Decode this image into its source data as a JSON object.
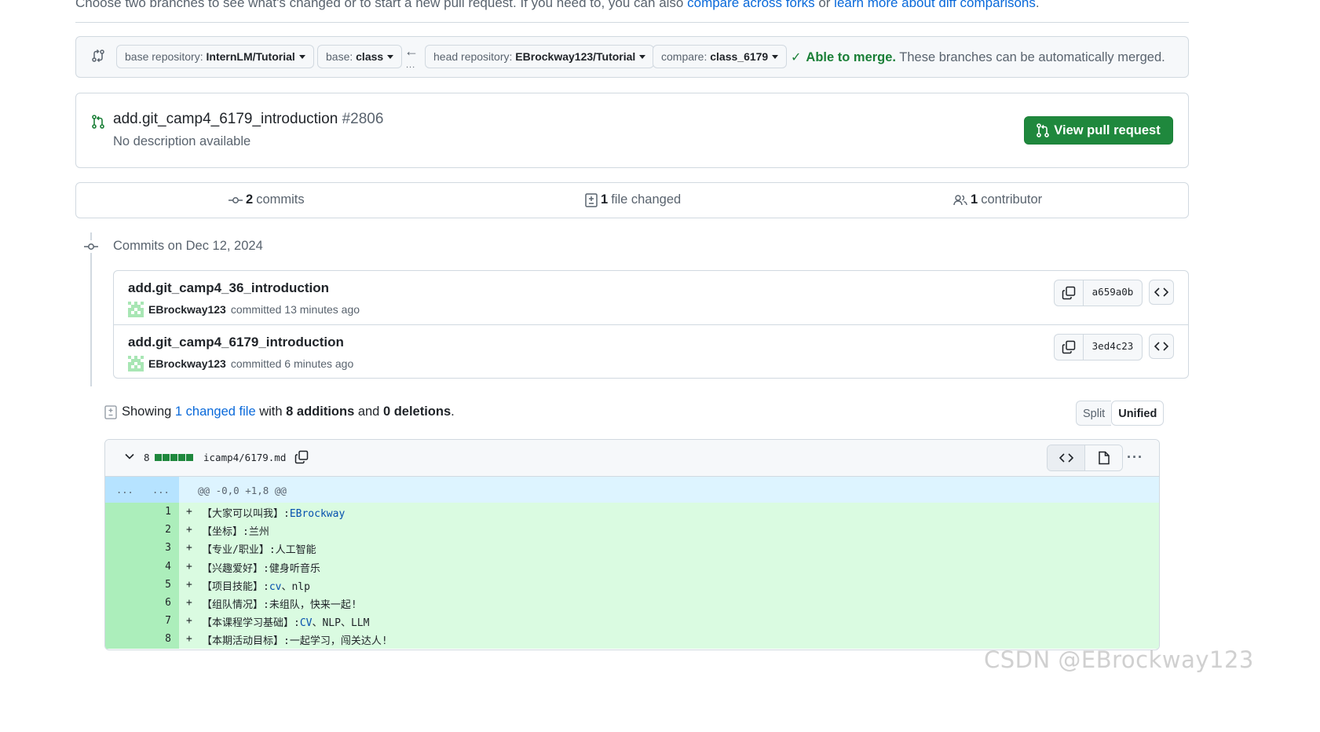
{
  "intro": {
    "text": "Choose two branches to see what's changed or to start a new pull request. If you need to, you can also ",
    "link1": "compare across forks",
    "or": " or ",
    "link2": "learn more about diff comparisons",
    "end": "."
  },
  "range": {
    "base_repo_label": "base repository: ",
    "base_repo_value": "InternLM/Tutorial",
    "base_label": "base: ",
    "base_value": "class",
    "head_repo_label": "head repository: ",
    "head_repo_value": "EBrockway123/Tutorial",
    "compare_label": "compare: ",
    "compare_value": "class_6179",
    "merge_ok": "Able to merge.",
    "merge_text": " These branches can be automatically merged."
  },
  "pr": {
    "title": "add.git_camp4_6179_introduction",
    "number": "#2806",
    "description": "No description available",
    "button": "View pull request"
  },
  "summary": {
    "commits_count": "2",
    "commits_label": " commits",
    "files_count": "1",
    "files_label": " file changed",
    "contributors_count": "1",
    "contributors_label": " contributor"
  },
  "commits": {
    "header": "Commits on Dec 12, 2024",
    "items": [
      {
        "title": "add.git_camp4_36_introduction",
        "author": "EBrockway123",
        "meta": " committed 13 minutes ago",
        "sha": "a659a0b"
      },
      {
        "title": "add.git_camp4_6179_introduction",
        "author": "EBrockway123",
        "meta": " committed 6 minutes ago",
        "sha": "3ed4c23"
      }
    ]
  },
  "showing": {
    "prefix": "Showing ",
    "link": "1 changed file",
    "mid": " with ",
    "additions": "8 additions",
    "and": " and ",
    "deletions": "0 deletions",
    "end": ".",
    "split": "Split",
    "unified": "Unified"
  },
  "diff": {
    "count": "8",
    "filename": "icamp4/6179.md",
    "hunk_gutter_left": "...",
    "hunk_gutter_right": "...",
    "hunk": "@@ -0,0 +1,8 @@",
    "lines": [
      {
        "num": "1",
        "sign": "+",
        "text": "【大家可以叫我】:",
        "tail": "EBrockway"
      },
      {
        "num": "2",
        "sign": "+",
        "text": "【坐标】:兰州",
        "tail": ""
      },
      {
        "num": "3",
        "sign": "+",
        "text": "【专业/职业】:人工智能",
        "tail": ""
      },
      {
        "num": "4",
        "sign": "+",
        "text": "【兴趣爱好】:健身听音乐",
        "tail": ""
      },
      {
        "num": "5",
        "sign": "+",
        "text": "【项目技能】:",
        "tail": "cv",
        "rest": "、nlp"
      },
      {
        "num": "6",
        "sign": "+",
        "text": "【组队情况】:未组队，快来一起!",
        "tail": ""
      },
      {
        "num": "7",
        "sign": "+",
        "text": "【本课程学习基础】:",
        "tail": "CV",
        "rest": "、NLP、LLM"
      },
      {
        "num": "8",
        "sign": "+",
        "text": "【本期活动目标】:一起学习，闯关达人!",
        "tail": ""
      }
    ]
  },
  "watermark": "CSDN @EBrockway123",
  "colors": {
    "accent_link": "#0969da",
    "success": "#1a7f37",
    "button_green": "#1f883d",
    "diff_add_bg": "#dafbe1",
    "diff_add_gutter": "#aceebb",
    "hunk_bg": "#ddf4ff"
  },
  "icons": [
    "compare-icon",
    "arrow-left-icon",
    "check-icon",
    "pull-request-icon",
    "commit-icon",
    "file-diff-icon",
    "people-icon",
    "copy-icon",
    "code-icon",
    "chevron-down-icon",
    "file-icon",
    "kebab-icon"
  ]
}
